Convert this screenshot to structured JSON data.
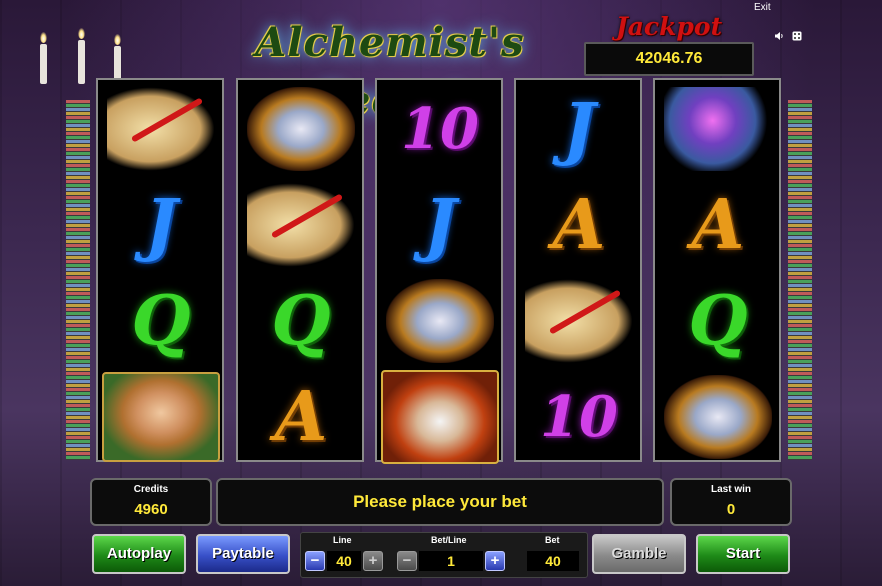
{
  "header": {
    "title": "Alchemist's Secret",
    "jackpot_label": "Jackpot",
    "jackpot_value": "42046.76",
    "exit_label": "Exit",
    "icons": [
      "speaker-icon",
      "settings-icon"
    ]
  },
  "reels": [
    {
      "symbols": [
        "scroll",
        "J",
        "Q",
        "girl"
      ]
    },
    {
      "symbols": [
        "owl",
        "scroll",
        "Q",
        "A"
      ]
    },
    {
      "symbols": [
        "10",
        "J",
        "owl",
        "wizard"
      ]
    },
    {
      "symbols": [
        "J",
        "A",
        "scroll",
        "10"
      ]
    },
    {
      "symbols": [
        "potion",
        "A",
        "Q",
        "owl"
      ]
    }
  ],
  "symbol_text": {
    "J": "J",
    "Q": "Q",
    "A": "A",
    "10": "10"
  },
  "panels": {
    "credits_label": "Credits",
    "credits_value": "4960",
    "message": "Please place your bet",
    "last_win_label": "Last win",
    "last_win_value": "0"
  },
  "controls": {
    "autoplay": "Autoplay",
    "paytable": "Paytable",
    "line_label": "Line",
    "line_value": "40",
    "bet_line_label": "Bet/Line",
    "bet_line_value": "1",
    "bet_label": "Bet",
    "bet_value": "40",
    "minus": "−",
    "plus": "+",
    "gamble": "Gamble",
    "start": "Start"
  }
}
